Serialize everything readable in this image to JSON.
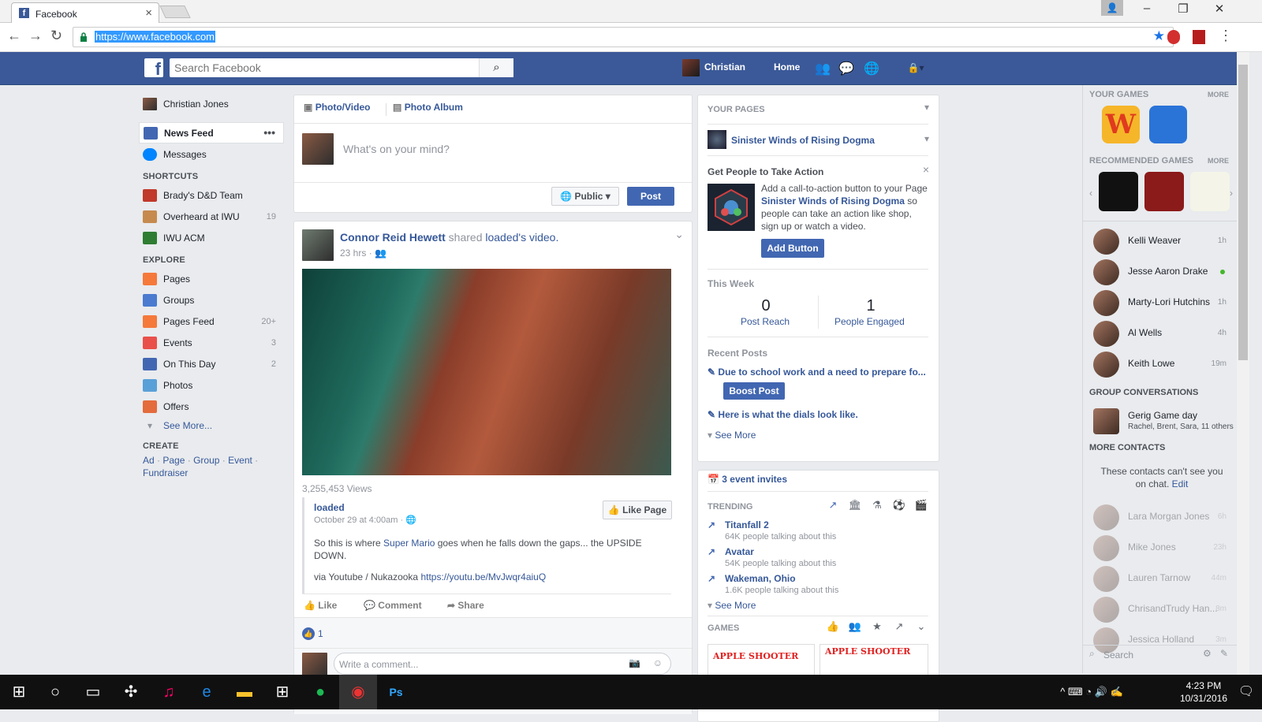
{
  "browser": {
    "tab_title": "Facebook",
    "url": "https://www.facebook.com"
  },
  "header": {
    "search_placeholder": "Search Facebook",
    "user_name": "Christian",
    "home_label": "Home"
  },
  "left_nav": {
    "profile_name": "Christian Jones",
    "items": [
      {
        "label": "News Feed",
        "icon": "news-feed-icon",
        "color": "#4267b2"
      },
      {
        "label": "Messages",
        "icon": "messages-icon",
        "color": "#0084ff"
      }
    ],
    "shortcuts_title": "SHORTCUTS",
    "shortcuts": [
      {
        "label": "Brady's D&D Team",
        "count": "",
        "color": "#c0392b"
      },
      {
        "label": "Overheard at IWU",
        "count": "19",
        "color": "#c68a4f"
      },
      {
        "label": "IWU ACM",
        "count": "",
        "color": "#2e7d32"
      }
    ],
    "explore_title": "EXPLORE",
    "explore": [
      {
        "label": "Pages",
        "count": "",
        "color": "#f5793b"
      },
      {
        "label": "Groups",
        "count": "",
        "color": "#4a7bd0"
      },
      {
        "label": "Pages Feed",
        "count": "20+",
        "color": "#f5793b"
      },
      {
        "label": "Events",
        "count": "3",
        "color": "#e9504a"
      },
      {
        "label": "On This Day",
        "count": "2",
        "color": "#4267b2"
      },
      {
        "label": "Photos",
        "count": "",
        "color": "#5aa0d8"
      },
      {
        "label": "Offers",
        "count": "",
        "color": "#e46b3c"
      }
    ],
    "see_more": "See More...",
    "create_title": "CREATE",
    "create_links": [
      "Ad",
      "Page",
      "Group",
      "Event",
      "Fundraiser"
    ]
  },
  "composer": {
    "tab_photo_video": "Photo/Video",
    "tab_photo_album": "Photo Album",
    "placeholder": "What's on your mind?",
    "privacy": "Public",
    "post_button": "Post"
  },
  "post": {
    "author": "Connor Reid Hewett",
    "shared_text": "shared",
    "source_link": "loaded",
    "source_suffix": "'s video.",
    "time": "23 hrs",
    "views": "3,255,453 Views",
    "page_name": "loaded",
    "page_date": "October 29 at 4:00am",
    "like_page": "Like Page",
    "caption_pre": "So this is where ",
    "caption_link": "Super Mario",
    "caption_post": " goes when he falls down the gaps... the UPSIDE DOWN.",
    "via_text": "via Youtube / Nukazooka ",
    "via_link": "https://youtu.be/MvJwqr4aiuQ",
    "like": "Like",
    "comment": "Comment",
    "share": "Share",
    "like_count": "1",
    "comment_placeholder": "Write a comment..."
  },
  "pages_panel": {
    "title": "YOUR PAGES",
    "page_name": "Sinister Winds of Rising Dogma",
    "cta_title": "Get People to Take Action",
    "cta_text_1": "Add a call-to-action button to your Page ",
    "cta_link": "Sinister Winds of Rising Dogma",
    "cta_text_2": " so people can take an action like shop, sign up or watch a video.",
    "add_button": "Add Button",
    "week_title": "This Week",
    "reach_value": "0",
    "reach_label": "Post Reach",
    "engaged_value": "1",
    "engaged_label": "People Engaged",
    "recent_title": "Recent Posts",
    "recent_1": "Due to school work and a need to prepare fo...",
    "boost": "Boost Post",
    "recent_2": "Here is what the dials look like.",
    "see_more": "See More"
  },
  "trending": {
    "event_invites": "3 event invites",
    "title": "TRENDING",
    "items": [
      {
        "topic": "Titanfall 2",
        "talk": "64K people talking about this"
      },
      {
        "topic": "Avatar",
        "talk": "54K people talking about this"
      },
      {
        "topic": "Wakeman, Ohio",
        "talk": "1.6K people talking about this"
      }
    ],
    "see_more": "See More",
    "games_title": "GAMES",
    "game_1": "APPLE SHOOTER",
    "game_2": "APPLE SHOOTER"
  },
  "chat": {
    "your_games": "YOUR GAMES",
    "more": "MORE",
    "recommended": "RECOMMENDED GAMES",
    "more2": "MORE",
    "contacts": [
      {
        "name": "Kelli Weaver",
        "time": "1h"
      },
      {
        "name": "Jesse Aaron Drake",
        "time": ""
      },
      {
        "name": "Marty-Lori Hutchins",
        "time": "1h"
      },
      {
        "name": "Al Wells",
        "time": "4h"
      },
      {
        "name": "Keith Lowe",
        "time": "19m"
      }
    ],
    "group_title": "GROUP CONVERSATIONS",
    "group_name": "Gerig Game day",
    "group_members": "Rachel, Brent, Sara, 11 others",
    "more_contacts": "MORE CONTACTS",
    "notice": "These contacts can't see you on chat.",
    "notice_edit": "Edit",
    "offline": [
      {
        "name": "Lara Morgan Jones",
        "time": "6h"
      },
      {
        "name": "Mike Jones",
        "time": "23h"
      },
      {
        "name": "Lauren Tarnow",
        "time": "44m"
      },
      {
        "name": "ChrisandTrudy Han...",
        "time": "8m"
      },
      {
        "name": "Jessica Holland",
        "time": "3m"
      }
    ],
    "search_placeholder": "Search"
  },
  "taskbar": {
    "time": "4:23 PM",
    "date": "10/31/2016"
  }
}
